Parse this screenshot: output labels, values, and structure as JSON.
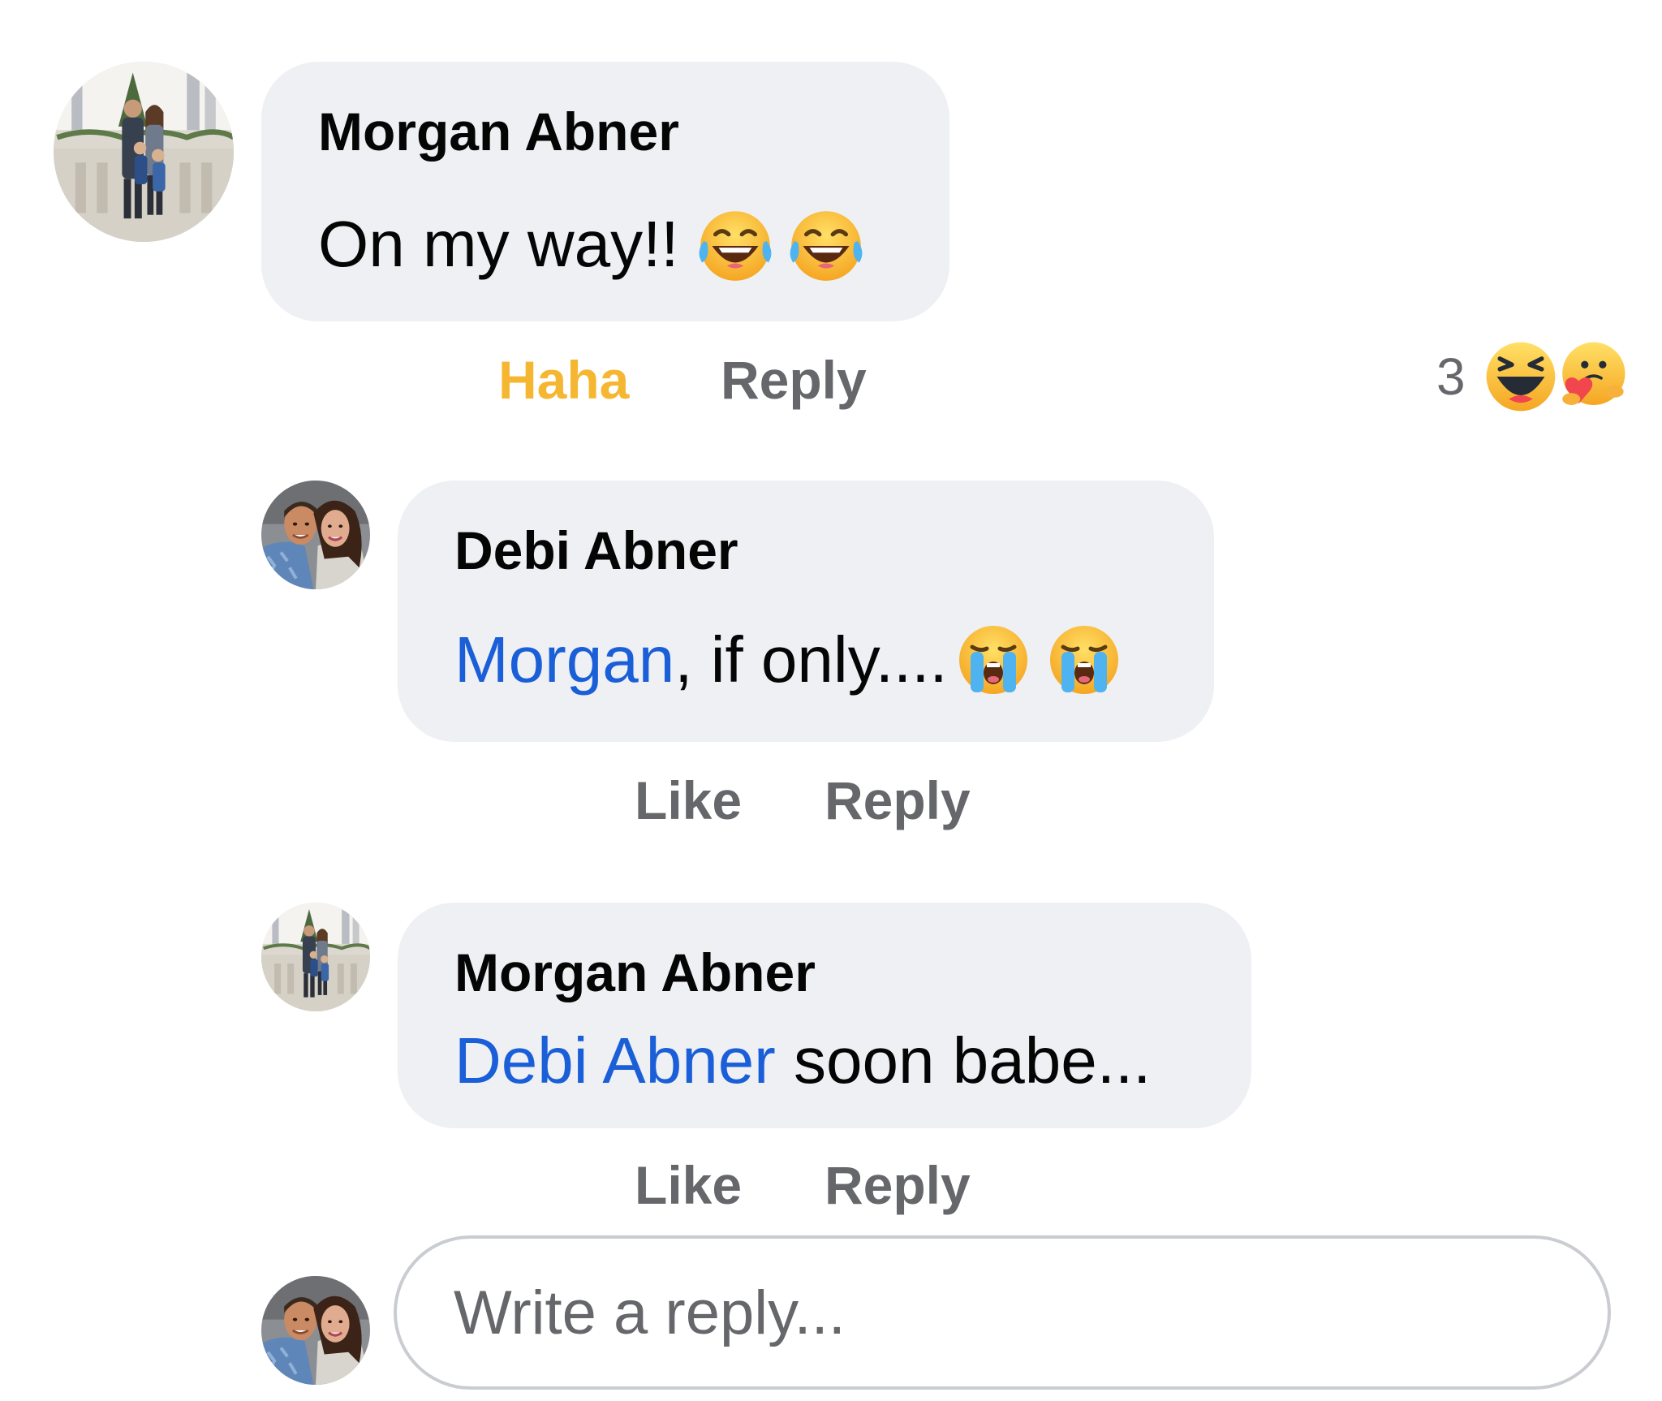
{
  "comments": [
    {
      "author": "Morgan Abner",
      "text": "On my way!!",
      "mention": "",
      "emojis": [
        "tears-of-joy-emoji",
        "tears-of-joy-emoji"
      ],
      "actions": {
        "reaction_label": "Haha",
        "reply_label": "Reply"
      },
      "reaction_summary": {
        "count": "3",
        "icons": [
          "haha-reaction-icon",
          "care-reaction-icon"
        ]
      }
    },
    {
      "author": "Debi Abner",
      "mention": "Morgan",
      "text": ", if only....",
      "emojis": [
        "loudly-crying-emoji",
        "loudly-crying-emoji"
      ],
      "actions": {
        "like_label": "Like",
        "reply_label": "Reply"
      }
    },
    {
      "author": "Morgan Abner",
      "mention": "Debi Abner",
      "text": " soon babe...",
      "emojis": [],
      "actions": {
        "like_label": "Like",
        "reply_label": "Reply"
      }
    }
  ],
  "reply_box": {
    "placeholder": "Write a reply..."
  },
  "colors": {
    "bubble": "#eef0f3",
    "mention": "#1a5fd8",
    "action_text": "#65676b",
    "haha_active": "#f5b731"
  }
}
